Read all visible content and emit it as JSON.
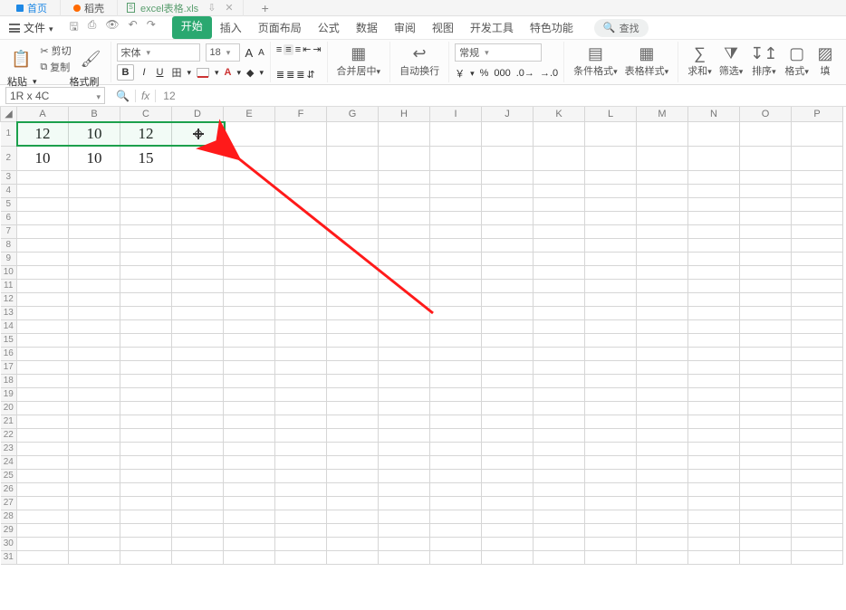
{
  "tabs": {
    "home": "首页",
    "daoke": "稻壳",
    "doc_name": "excel表格.xls",
    "tools": {
      "pin": "⇩",
      "close": "✕",
      "add": "+"
    }
  },
  "menu": {
    "file": "文件",
    "quick": {
      "save": "🖫",
      "print": "⎙",
      "preview": "👁",
      "undo": "↶",
      "redo": "↷"
    },
    "items": [
      "开始",
      "插入",
      "页面布局",
      "公式",
      "数据",
      "审阅",
      "视图",
      "开发工具",
      "特色功能"
    ],
    "search_icon": "🔍",
    "search_label": "查找"
  },
  "ribbon": {
    "paste": {
      "label": "粘贴",
      "dd": "▾"
    },
    "clip": {
      "cut": "剪切",
      "copy": "复制",
      "painter": "格式刷"
    },
    "font": {
      "name": "宋体",
      "size": "18",
      "grow": "A",
      "shrink": "A",
      "b": "B",
      "i": "I",
      "u": "U",
      "border": "田",
      "fill": "◧",
      "color": "A",
      "highlight": "◆"
    },
    "align": {
      "tl": "≡",
      "tc": "≡",
      "tr": "≡",
      "outdent": "⇤",
      "indent": "⇥",
      "bl": "≣",
      "bc": "≣",
      "br": "≣",
      "wrap": "⇵"
    },
    "merge": {
      "label": "合并居中"
    },
    "wrap": {
      "label": "自动换行"
    },
    "number": {
      "format": "常规",
      "cur": "￥",
      "pct": "%",
      "comma": "000",
      "inc": "⬆0",
      "dec": "⬇0"
    },
    "cond": {
      "label": "条件格式"
    },
    "tablestyle": {
      "label": "表格样式"
    },
    "right": {
      "sum": "求和",
      "filter": "筛选",
      "sort": "排序",
      "format": "格式",
      "fill": "填"
    }
  },
  "fx": {
    "name_box": "1R x 4C",
    "zoom": "🔍",
    "fx": "fx",
    "value": "12"
  },
  "sheet": {
    "cols": [
      "A",
      "B",
      "C",
      "D",
      "E",
      "F",
      "G",
      "H",
      "I",
      "J",
      "K",
      "L",
      "M",
      "N",
      "O",
      "P"
    ],
    "row_count": 31,
    "data": {
      "r1": {
        "A": "12",
        "B": "10",
        "C": "12",
        "D": ""
      },
      "r2": {
        "A": "10",
        "B": "10",
        "C": "15"
      }
    }
  },
  "chart_data": {
    "type": "table",
    "columns": [
      "A",
      "B",
      "C",
      "D"
    ],
    "rows": [
      [
        12,
        10,
        12,
        null
      ],
      [
        10,
        10,
        15,
        null
      ]
    ],
    "selection": "A1:D1",
    "formula_bar_value": 12
  }
}
